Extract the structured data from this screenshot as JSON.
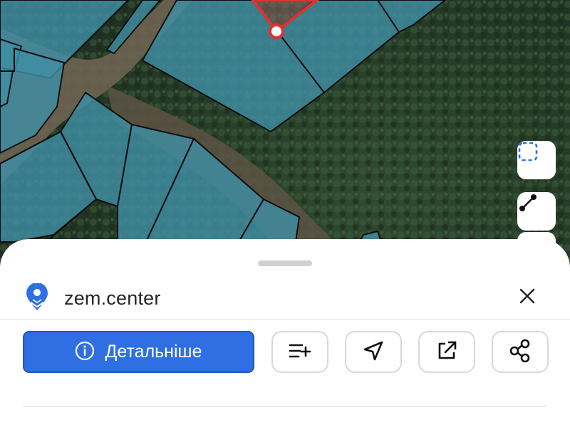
{
  "map": {
    "parcel_fill": "#3f8ea3",
    "parcel_stroke": "#0b0f12",
    "selected_parcel_stroke": "#e0312f",
    "tools": [
      {
        "icon": "select-area-icon"
      },
      {
        "icon": "measure-line-icon"
      }
    ]
  },
  "sheet": {
    "site_name": "zem.center",
    "logo_icon": "location-pin-icon",
    "close_icon": "close-icon",
    "details_label": "Детальніше",
    "accent_color": "#2f6fe3",
    "actions": [
      {
        "icon": "add-to-list-icon"
      },
      {
        "icon": "navigate-icon"
      },
      {
        "icon": "open-external-icon"
      },
      {
        "icon": "share-icon"
      }
    ]
  }
}
